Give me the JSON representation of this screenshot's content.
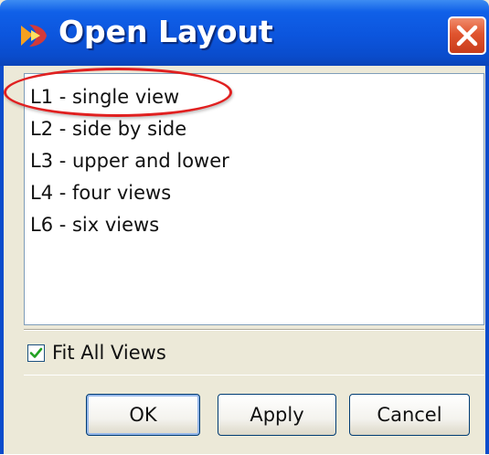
{
  "dialog": {
    "title": "Open Layout",
    "icon": "app-logo-icon",
    "close_icon": "close-icon"
  },
  "layouts": {
    "items": [
      {
        "label": "L1 - single view"
      },
      {
        "label": "L2 - side by side"
      },
      {
        "label": "L3 - upper and lower"
      },
      {
        "label": "L4 - four views"
      },
      {
        "label": "L6 - six views"
      }
    ]
  },
  "options": {
    "fit_all_views_label": "Fit All Views",
    "fit_all_views_checked": true
  },
  "buttons": {
    "ok": "OK",
    "apply": "Apply",
    "cancel": "Cancel"
  },
  "colors": {
    "titlebar": "#0a4ccc",
    "highlight_annotation": "#e02020",
    "close_button": "#e0542e"
  }
}
